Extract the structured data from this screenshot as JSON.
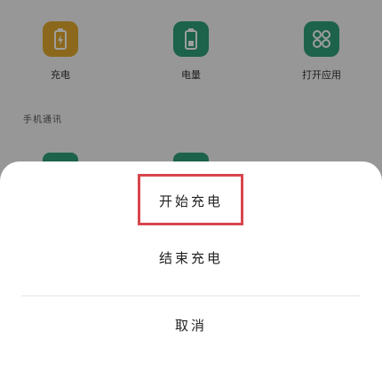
{
  "background": {
    "apps": [
      {
        "label": "充电",
        "icon": "battery-charging-icon",
        "color": "#e0a82e"
      },
      {
        "label": "电量",
        "icon": "battery-icon",
        "color": "#2f9e7a"
      },
      {
        "label": "打开应用",
        "icon": "app-grid-icon",
        "color": "#2f9e7a"
      }
    ],
    "section_title": "手机通讯"
  },
  "sheet": {
    "start_label": "开始充电",
    "stop_label": "结束充电",
    "cancel_label": "取消"
  },
  "colors": {
    "highlight": "#d8454d",
    "accent_green": "#2f9e7a",
    "accent_yellow": "#e0a82e"
  }
}
